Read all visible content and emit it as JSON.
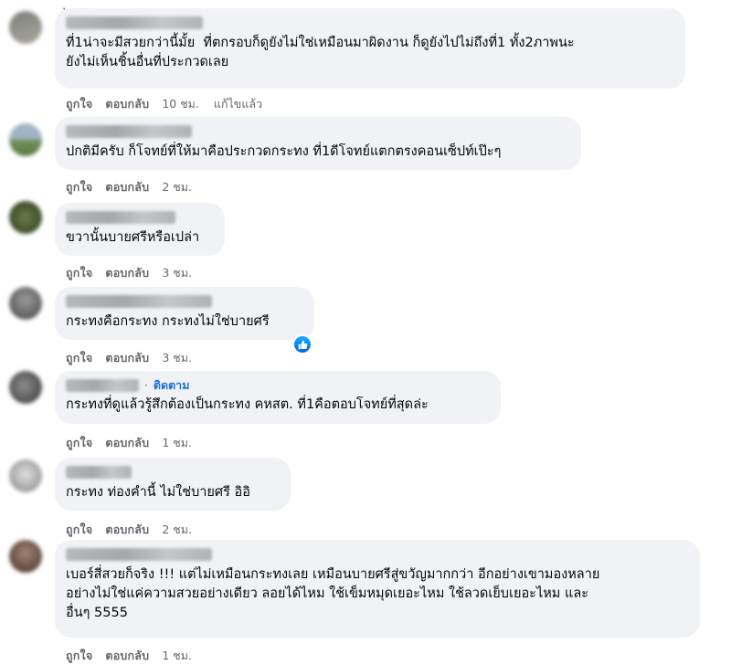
{
  "comments": [
    {
      "text": "ที่1น่าจะมีสวยกว่านี้มั้ย  ที่ตกรอบก็ดูยังไม่ใช่เหมือนมาผิดงาน ก็ดูยังไปไม่ถึงที่1 ทั้ง2ภาพนะ\nยังไม่เห็นชิ้นอื่นที่ประกวดเลย",
      "like": "ถูกใจ",
      "reply": "ตอบกลับ",
      "time": "10 ชม.",
      "edited": "แก้ไขแล้ว",
      "avatar_colors": [
        "#7d7f7c",
        "#a9a69c"
      ]
    },
    {
      "text": "ปกติมีครับ ก็โจทย์ที่ให้มาคือประกวดกระทง ที่1ดีโจทย์แตกตรงคอนเซ็ปท์เป๊ะๆ",
      "like": "ถูกใจ",
      "reply": "ตอบกลับ",
      "time": "2 ชม.",
      "avatar_colors": [
        "#8fa4b6",
        "#6f8f58"
      ]
    },
    {
      "text": "ขวานั้นบายศรีหรือเปล่า",
      "like": "ถูกใจ",
      "reply": "ตอบกลับ",
      "time": "3 ชม.",
      "avatar_colors": [
        "#5a6b3e",
        "#3e4d2b"
      ]
    },
    {
      "text": "กระทงคือกระทง กระทงไม่ใช่บายศรี",
      "like": "ถูกใจ",
      "reply": "ตอบกลับ",
      "time": "3 ชม.",
      "avatar_colors": [
        "#888888",
        "#5e5e5e"
      ],
      "reaction": "like-reaction"
    },
    {
      "follow": "ติดตาม",
      "separator": "·",
      "text": "กระทงที่ดูแล้วรู้สึกต้องเป็นกระทง คหสต. ที่1คือตอบโจทย์ที่สุดล่ะ",
      "like": "ถูกใจ",
      "reply": "ตอบกลับ",
      "time": "1 ชม.",
      "avatar_colors": [
        "#6e6e6e",
        "#4c4c4c"
      ]
    },
    {
      "text": "กระทง ท่องคำนี้ ไม่ใช่บายศรี อิอิ",
      "like": "ถูกใจ",
      "reply": "ตอบกลับ",
      "time": "2 ชม.",
      "avatar_colors": [
        "#c9c9c9",
        "#9a9a9a"
      ]
    },
    {
      "text": "เบอร์สี่สวยก็จริง !!! แต่ไม่เหมือนกระทงเลย เหมือนบายศรีสู่ขวัญมากกว่า อีกอย่างเขามองหลาย\nอย่างไม่ใช่แค่ความสวยอย่างเดียว ลอยได้ไหม ใช้เข็มหมุดเยอะไหม ใช้ลวดเย็บเยอะไหม และ\nอื่นๆ 5555",
      "like": "ถูกใจ",
      "reply": "ตอบกลับ",
      "time": "1 ชม.",
      "avatar_colors": [
        "#8a6c5f",
        "#5b443a"
      ]
    }
  ],
  "colors": {
    "bubble": "#f0f2f5",
    "meta": "#65676b",
    "link": "#216fdb",
    "like_blue": "#0866ff"
  }
}
